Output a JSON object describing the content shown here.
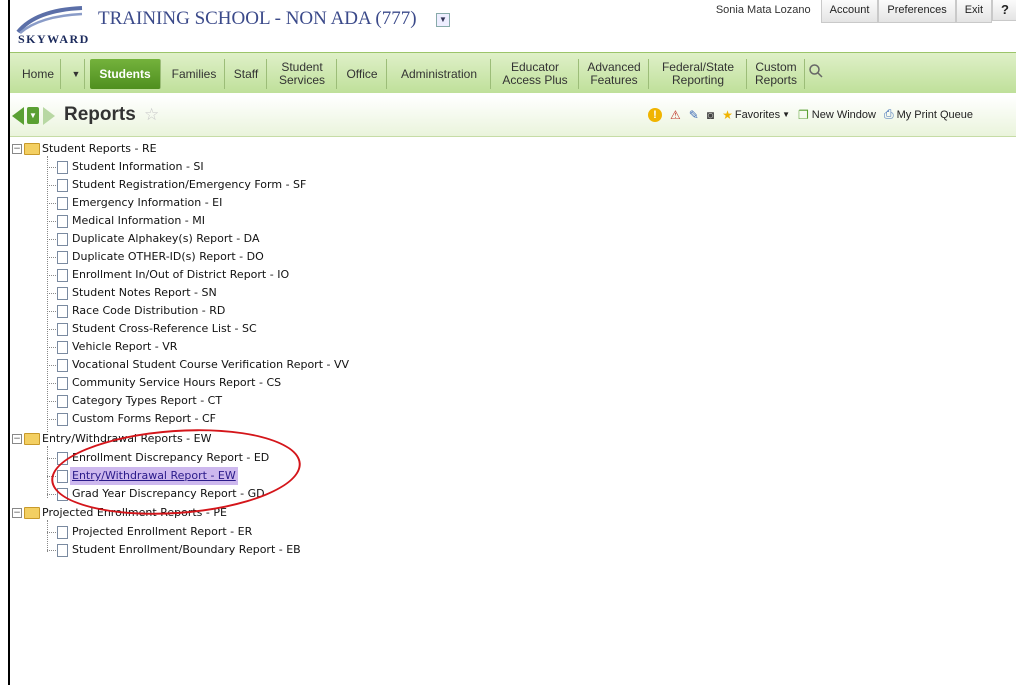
{
  "app": {
    "logo_text": "SKYWARD",
    "school_title": "TRAINING SCHOOL - NON ADA (777)"
  },
  "topmenu": {
    "user": "Sonia Mata Lozano",
    "items": [
      "Account",
      "Preferences",
      "Exit",
      "?"
    ]
  },
  "nav": {
    "tabs": [
      "Home",
      "Students",
      "Families",
      "Staff",
      "Student Services",
      "Office",
      "Administration",
      "Educator Access Plus",
      "Advanced Features",
      "Federal/State Reporting",
      "Custom Reports"
    ],
    "active": "Students"
  },
  "page": {
    "title": "Reports"
  },
  "toolbar": {
    "favorites": "Favorites",
    "new_window": "New Window",
    "print_queue": "My Print Queue"
  },
  "tree": {
    "groups": [
      {
        "label": "Student Reports - RE",
        "items": [
          "Student Information - SI",
          "Student Registration/Emergency Form - SF",
          "Emergency Information - EI",
          "Medical Information - MI",
          "Duplicate Alphakey(s) Report - DA",
          "Duplicate OTHER-ID(s) Report - DO",
          "Enrollment In/Out of District Report - IO",
          "Student Notes Report - SN",
          "Race Code Distribution - RD",
          "Student Cross-Reference List - SC",
          "Vehicle Report - VR",
          "Vocational Student Course Verification Report - VV",
          "Community Service Hours Report - CS",
          "Category Types Report - CT",
          "Custom Forms Report - CF"
        ]
      },
      {
        "label": "Entry/Withdrawal Reports - EW",
        "items": [
          "Enrollment Discrepancy Report - ED",
          "Entry/Withdrawal Report - EW",
          "Grad Year Discrepancy Report - GD"
        ]
      },
      {
        "label": "Projected Enrollment Reports - PE",
        "items": [
          "Projected Enrollment Report - ER",
          "Student Enrollment/Boundary Report - EB"
        ]
      }
    ],
    "selected": "Entry/Withdrawal Report - EW"
  },
  "colors": {
    "accent_green": "#5aa033",
    "annotation_red": "#d4151a",
    "selection": "#cdb8ee"
  }
}
